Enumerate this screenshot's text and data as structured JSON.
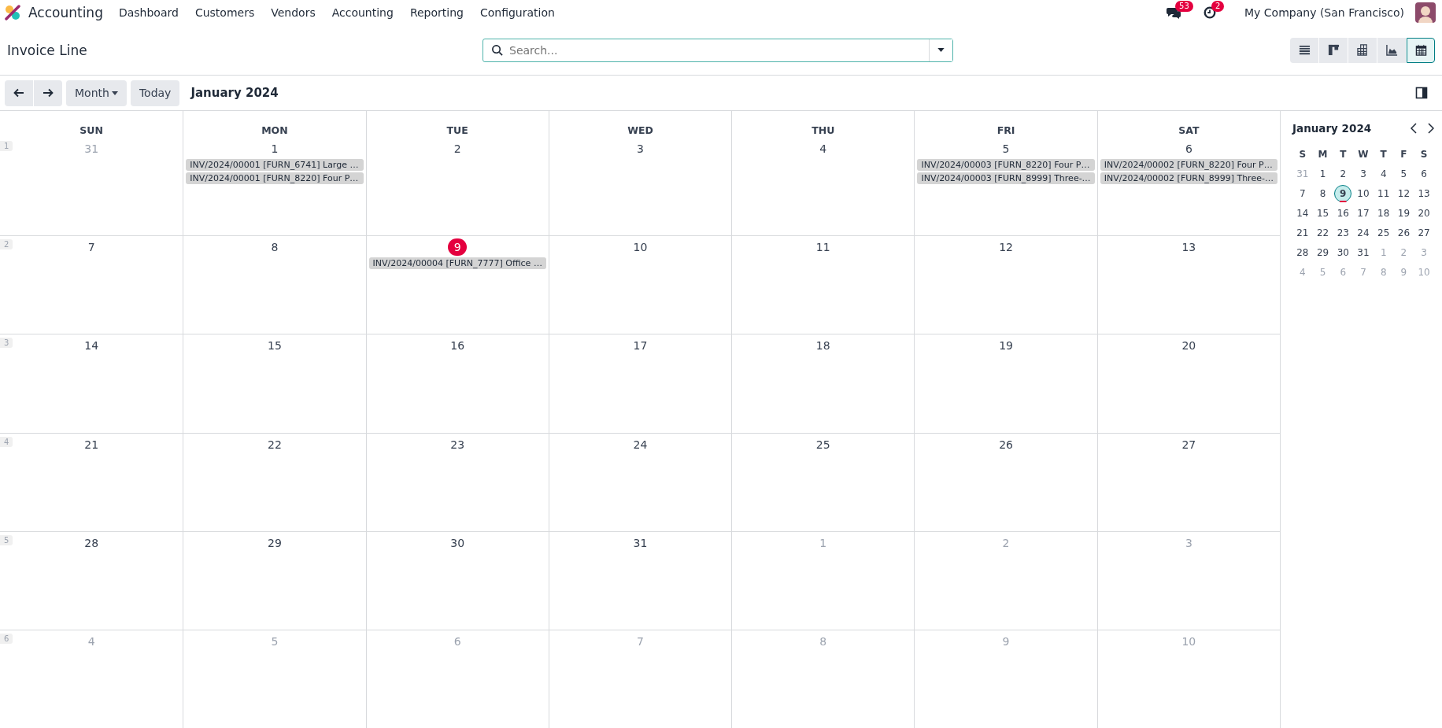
{
  "app": {
    "name": "Accounting"
  },
  "menu": [
    {
      "label": "Dashboard"
    },
    {
      "label": "Customers"
    },
    {
      "label": "Vendors"
    },
    {
      "label": "Accounting"
    },
    {
      "label": "Reporting"
    },
    {
      "label": "Configuration"
    }
  ],
  "systray": {
    "messages_badge": "53",
    "activities_badge": "2",
    "company": "My Company (San Francisco)"
  },
  "breadcrumb": "Invoice Line",
  "search": {
    "placeholder": "Search..."
  },
  "views": [
    {
      "kind": "list",
      "selected": false
    },
    {
      "kind": "kanban",
      "selected": false
    },
    {
      "kind": "pivot",
      "selected": false
    },
    {
      "kind": "graph",
      "selected": false
    },
    {
      "kind": "calendar",
      "selected": true
    }
  ],
  "toolbar": {
    "scale": "Month",
    "today": "Today",
    "period": "January 2024"
  },
  "calendar": {
    "weekdays": [
      "SUN",
      "MON",
      "TUE",
      "WED",
      "THU",
      "FRI",
      "SAT"
    ],
    "weeks": [
      {
        "number": "1",
        "days": [
          {
            "day": "31",
            "other_month": true,
            "today": false
          },
          {
            "day": "1",
            "other_month": false,
            "today": false,
            "events": [
              "INV/2024/00001 [FURN_6741] Large …",
              "INV/2024/00001 [FURN_8220] Four P…"
            ]
          },
          {
            "day": "2",
            "other_month": false,
            "today": false
          },
          {
            "day": "3",
            "other_month": false,
            "today": false
          },
          {
            "day": "4",
            "other_month": false,
            "today": false
          },
          {
            "day": "5",
            "other_month": false,
            "today": false,
            "events": [
              "INV/2024/00003 [FURN_8220] Four P…",
              "INV/2024/00003 [FURN_8999] Three-…"
            ]
          },
          {
            "day": "6",
            "other_month": false,
            "today": false,
            "events": [
              "INV/2024/00002 [FURN_8220] Four P…",
              "INV/2024/00002 [FURN_8999] Three-…"
            ]
          }
        ]
      },
      {
        "number": "2",
        "days": [
          {
            "day": "7",
            "other_month": false,
            "today": false
          },
          {
            "day": "8",
            "other_month": false,
            "today": false
          },
          {
            "day": "9",
            "other_month": false,
            "today": true,
            "events": [
              "INV/2024/00004 [FURN_7777] Office …"
            ]
          },
          {
            "day": "10",
            "other_month": false,
            "today": false
          },
          {
            "day": "11",
            "other_month": false,
            "today": false
          },
          {
            "day": "12",
            "other_month": false,
            "today": false
          },
          {
            "day": "13",
            "other_month": false,
            "today": false
          }
        ]
      },
      {
        "number": "3",
        "days": [
          {
            "day": "14",
            "other_month": false,
            "today": false
          },
          {
            "day": "15",
            "other_month": false,
            "today": false
          },
          {
            "day": "16",
            "other_month": false,
            "today": false
          },
          {
            "day": "17",
            "other_month": false,
            "today": false
          },
          {
            "day": "18",
            "other_month": false,
            "today": false
          },
          {
            "day": "19",
            "other_month": false,
            "today": false
          },
          {
            "day": "20",
            "other_month": false,
            "today": false
          }
        ]
      },
      {
        "number": "4",
        "days": [
          {
            "day": "21",
            "other_month": false,
            "today": false
          },
          {
            "day": "22",
            "other_month": false,
            "today": false
          },
          {
            "day": "23",
            "other_month": false,
            "today": false
          },
          {
            "day": "24",
            "other_month": false,
            "today": false
          },
          {
            "day": "25",
            "other_month": false,
            "today": false
          },
          {
            "day": "26",
            "other_month": false,
            "today": false
          },
          {
            "day": "27",
            "other_month": false,
            "today": false
          }
        ]
      },
      {
        "number": "5",
        "days": [
          {
            "day": "28",
            "other_month": false,
            "today": false
          },
          {
            "day": "29",
            "other_month": false,
            "today": false
          },
          {
            "day": "30",
            "other_month": false,
            "today": false
          },
          {
            "day": "31",
            "other_month": false,
            "today": false
          },
          {
            "day": "1",
            "other_month": true,
            "today": false
          },
          {
            "day": "2",
            "other_month": true,
            "today": false
          },
          {
            "day": "3",
            "other_month": true,
            "today": false
          }
        ]
      },
      {
        "number": "6",
        "days": [
          {
            "day": "4",
            "other_month": true,
            "today": false
          },
          {
            "day": "5",
            "other_month": true,
            "today": false
          },
          {
            "day": "6",
            "other_month": true,
            "today": false
          },
          {
            "day": "7",
            "other_month": true,
            "today": false
          },
          {
            "day": "8",
            "other_month": true,
            "today": false
          },
          {
            "day": "9",
            "other_month": true,
            "today": false
          },
          {
            "day": "10",
            "other_month": true,
            "today": false
          }
        ]
      }
    ]
  },
  "mini_calendar": {
    "title": "January 2024",
    "weekdays": [
      "S",
      "M",
      "T",
      "W",
      "T",
      "F",
      "S"
    ],
    "weeks": [
      [
        {
          "day": "31",
          "other_month": true,
          "selected": false,
          "today": false
        },
        {
          "day": "1",
          "other_month": false,
          "selected": false,
          "today": false
        },
        {
          "day": "2",
          "other_month": false,
          "selected": false,
          "today": false
        },
        {
          "day": "3",
          "other_month": false,
          "selected": false,
          "today": false
        },
        {
          "day": "4",
          "other_month": false,
          "selected": false,
          "today": false
        },
        {
          "day": "5",
          "other_month": false,
          "selected": false,
          "today": false
        },
        {
          "day": "6",
          "other_month": false,
          "selected": false,
          "today": false
        }
      ],
      [
        {
          "day": "7",
          "other_month": false,
          "selected": false,
          "today": false
        },
        {
          "day": "8",
          "other_month": false,
          "selected": false,
          "today": false
        },
        {
          "day": "9",
          "other_month": false,
          "selected": true,
          "today": true
        },
        {
          "day": "10",
          "other_month": false,
          "selected": false,
          "today": false
        },
        {
          "day": "11",
          "other_month": false,
          "selected": false,
          "today": false
        },
        {
          "day": "12",
          "other_month": false,
          "selected": false,
          "today": false
        },
        {
          "day": "13",
          "other_month": false,
          "selected": false,
          "today": false
        }
      ],
      [
        {
          "day": "14",
          "other_month": false,
          "selected": false,
          "today": false
        },
        {
          "day": "15",
          "other_month": false,
          "selected": false,
          "today": false
        },
        {
          "day": "16",
          "other_month": false,
          "selected": false,
          "today": false
        },
        {
          "day": "17",
          "other_month": false,
          "selected": false,
          "today": false
        },
        {
          "day": "18",
          "other_month": false,
          "selected": false,
          "today": false
        },
        {
          "day": "19",
          "other_month": false,
          "selected": false,
          "today": false
        },
        {
          "day": "20",
          "other_month": false,
          "selected": false,
          "today": false
        }
      ],
      [
        {
          "day": "21",
          "other_month": false,
          "selected": false,
          "today": false
        },
        {
          "day": "22",
          "other_month": false,
          "selected": false,
          "today": false
        },
        {
          "day": "23",
          "other_month": false,
          "selected": false,
          "today": false
        },
        {
          "day": "24",
          "other_month": false,
          "selected": false,
          "today": false
        },
        {
          "day": "25",
          "other_month": false,
          "selected": false,
          "today": false
        },
        {
          "day": "26",
          "other_month": false,
          "selected": false,
          "today": false
        },
        {
          "day": "27",
          "other_month": false,
          "selected": false,
          "today": false
        }
      ],
      [
        {
          "day": "28",
          "other_month": false,
          "selected": false,
          "today": false
        },
        {
          "day": "29",
          "other_month": false,
          "selected": false,
          "today": false
        },
        {
          "day": "30",
          "other_month": false,
          "selected": false,
          "today": false
        },
        {
          "day": "31",
          "other_month": false,
          "selected": false,
          "today": false
        },
        {
          "day": "1",
          "other_month": true,
          "selected": false,
          "today": false
        },
        {
          "day": "2",
          "other_month": true,
          "selected": false,
          "today": false
        },
        {
          "day": "3",
          "other_month": true,
          "selected": false,
          "today": false
        }
      ],
      [
        {
          "day": "4",
          "other_month": true,
          "selected": false,
          "today": false
        },
        {
          "day": "5",
          "other_month": true,
          "selected": false,
          "today": false
        },
        {
          "day": "6",
          "other_month": true,
          "selected": false,
          "today": false
        },
        {
          "day": "7",
          "other_month": true,
          "selected": false,
          "today": false
        },
        {
          "day": "8",
          "other_month": true,
          "selected": false,
          "today": false
        },
        {
          "day": "9",
          "other_month": true,
          "selected": false,
          "today": false
        },
        {
          "day": "10",
          "other_month": true,
          "selected": false,
          "today": false
        }
      ]
    ]
  }
}
